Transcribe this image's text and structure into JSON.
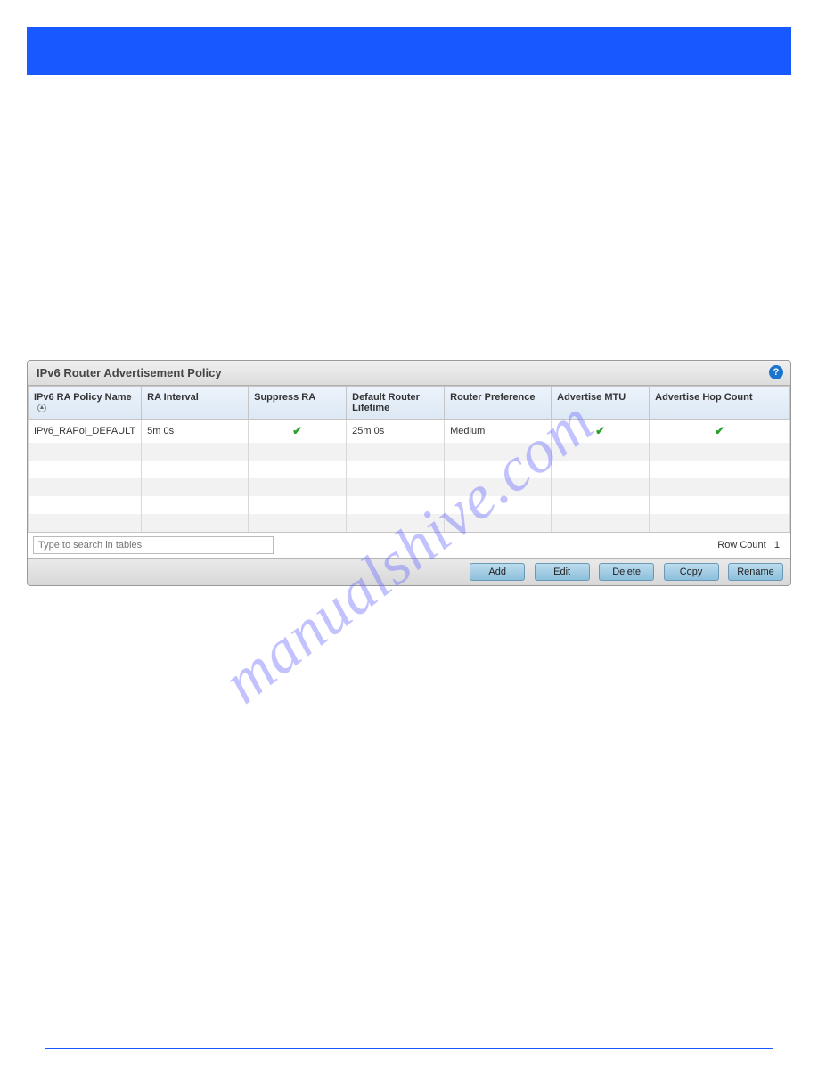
{
  "watermark": "manualshive.com",
  "panel": {
    "title": "IPv6 Router Advertisement Policy"
  },
  "table": {
    "headers": {
      "name": "IPv6 RA Policy Name",
      "interval": "RA Interval",
      "suppress": "Suppress RA",
      "lifetime": "Default Router Lifetime",
      "preference": "Router Preference",
      "mtu": "Advertise MTU",
      "hop": "Advertise Hop Count"
    },
    "rows": [
      {
        "name": "IPv6_RAPol_DEFAULT",
        "interval": "5m 0s",
        "suppress": true,
        "lifetime": "25m 0s",
        "preference": "Medium",
        "mtu": true,
        "hop": true
      }
    ]
  },
  "search": {
    "placeholder": "Type to search in tables",
    "rowCountLabel": "Row Count",
    "rowCountValue": "1"
  },
  "buttons": {
    "add": "Add",
    "edit": "Edit",
    "delete": "Delete",
    "copy": "Copy",
    "rename": "Rename"
  },
  "icons": {
    "help": "?",
    "check": "✔"
  }
}
